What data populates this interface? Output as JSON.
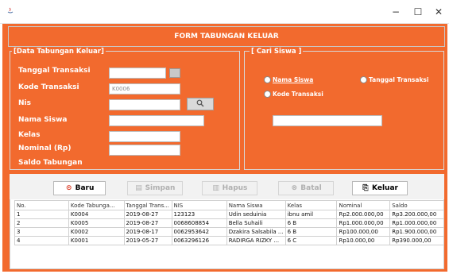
{
  "window": {
    "minimize": "−",
    "maximize": "☐",
    "close": "✕"
  },
  "header": {
    "title": "FORM TABUNGAN KELUAR"
  },
  "left_panel": {
    "legend": "[Data Tabungan Keluar]",
    "labels": {
      "tanggal": "Tanggal Transaksi",
      "kode": "Kode Transaksi",
      "nis": "Nis",
      "nama": "Nama Siswa",
      "kelas": "Kelas",
      "nominal": "Nominal (Rp)",
      "saldo": "Saldo Tabungan"
    },
    "values": {
      "kode": "K0006"
    }
  },
  "right_panel": {
    "legend": "[ Cari Siswa ]",
    "radio_nama": "Nama Siswa",
    "radio_tanggal": "Tanggal Transaksi",
    "radio_kode": "Kode Transaksi"
  },
  "buttons": {
    "baru": "Baru",
    "simpan": "Simpan",
    "hapus": "Hapus",
    "batal": "Batal",
    "keluar": "Keluar"
  },
  "table": {
    "headers": [
      "No.",
      "Kode Tabunga...",
      "Tanggal Trans...",
      "NIS",
      "Nama Siswa",
      "Kelas",
      "Nominal",
      "Saldo"
    ],
    "rows": [
      [
        "1",
        "K0004",
        "2019-08-27",
        "123123",
        "Udin seduinia",
        "ibnu amil",
        "Rp2.000.000,00",
        "Rp3.200.000,00"
      ],
      [
        "2",
        "K0005",
        "2019-08-27",
        "0068608854",
        "Bella Suhaili",
        "6 B",
        "Rp1.000.000,00",
        "Rp1.000.000,00"
      ],
      [
        "3",
        "K0002",
        "2019-08-17",
        "0062953642",
        "Dzakira Salsabila ...",
        "6 B",
        "Rp100.000,00",
        "Rp1.900.000,00"
      ],
      [
        "4",
        "K0001",
        "2019-05-27",
        "0063296126",
        "RADIRGA RIZKY ...",
        "6 C",
        "Rp10.000,00",
        "Rp390.000,00"
      ]
    ]
  }
}
